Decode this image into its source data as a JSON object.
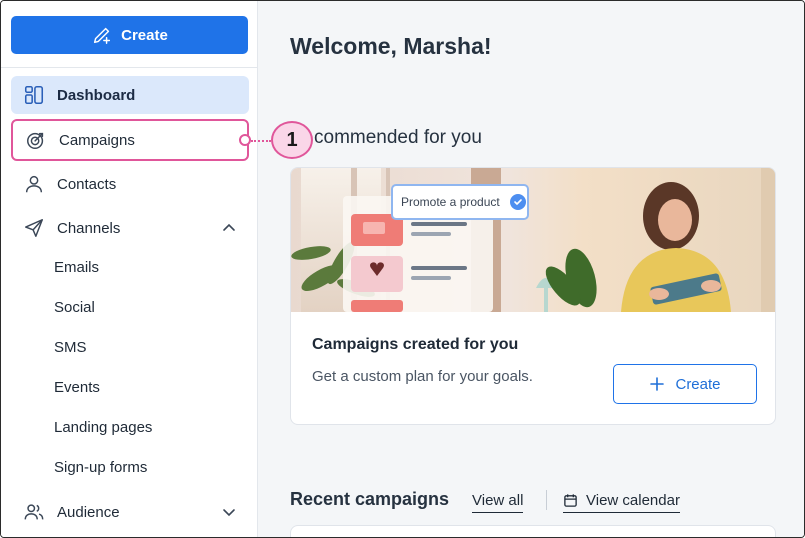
{
  "sidebar": {
    "create_label": "Create",
    "items": [
      {
        "label": "Dashboard",
        "icon": "dashboard-icon"
      },
      {
        "label": "Campaigns",
        "icon": "target-icon"
      },
      {
        "label": "Contacts",
        "icon": "person-icon"
      },
      {
        "label": "Channels",
        "icon": "send-icon"
      },
      {
        "label": "Audience",
        "icon": "people-icon"
      }
    ],
    "channels_sub": [
      "Emails",
      "Social",
      "SMS",
      "Events",
      "Landing pages",
      "Sign-up forms"
    ]
  },
  "callout": {
    "number": "1"
  },
  "main": {
    "welcome": "Welcome, Marsha!",
    "recommended_title": "commended for you",
    "card": {
      "chip_label": "Promote a product",
      "title": "Campaigns created for you",
      "subtitle": "Get a custom plan for your goals.",
      "create_label": "Create"
    },
    "recent": {
      "title": "Recent campaigns",
      "view_all": "View all",
      "view_calendar": "View calendar"
    }
  },
  "colors": {
    "accent": "#1f73e8",
    "active_bg": "#dbe8fb",
    "highlight": "#e0569a"
  }
}
